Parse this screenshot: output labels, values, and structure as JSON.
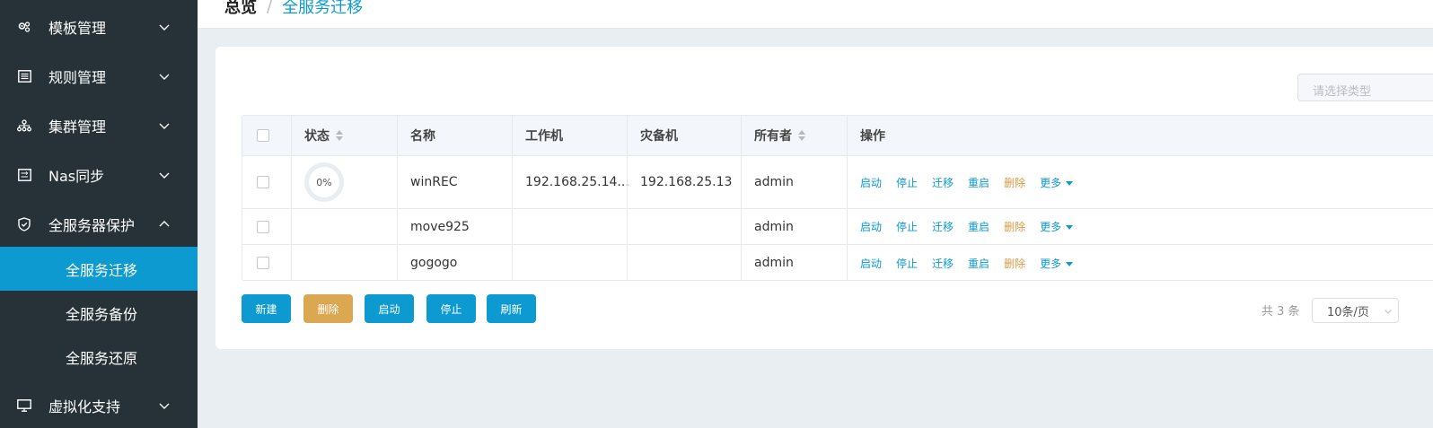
{
  "sidebar": {
    "items": [
      {
        "label": "模板管理",
        "icon": "gears-icon"
      },
      {
        "label": "规则管理",
        "icon": "list-icon"
      },
      {
        "label": "集群管理",
        "icon": "cluster-icon"
      },
      {
        "label": "Nas同步",
        "icon": "nas-icon"
      },
      {
        "label": "全服务器保护",
        "icon": "shield-icon",
        "expanded": true
      },
      {
        "label": "虚拟化支持",
        "icon": "monitor-icon"
      }
    ],
    "sub_items": [
      {
        "label": "全服务迁移",
        "active": true
      },
      {
        "label": "全服务备份"
      },
      {
        "label": "全服务还原"
      }
    ]
  },
  "breadcrumb": {
    "home": "总览",
    "separator": "/",
    "current": "全服务迁移"
  },
  "filter": {
    "type_placeholder": "请选择类型"
  },
  "table": {
    "columns": [
      "状态",
      "名称",
      "工作机",
      "灾备机",
      "所有者",
      "操作"
    ],
    "rows": [
      {
        "status": "0%",
        "name": "winREC",
        "work": "192.168.25.14...",
        "backup": "192.168.25.13",
        "owner": "admin"
      },
      {
        "status": "",
        "name": "move925",
        "work": "",
        "backup": "",
        "owner": "admin"
      },
      {
        "status": "",
        "name": "gogogo",
        "work": "",
        "backup": "",
        "owner": "admin"
      }
    ],
    "actions": [
      "启动",
      "停止",
      "迁移",
      "重启",
      "删除",
      "更多"
    ]
  },
  "buttons": {
    "new": "新建",
    "delete": "删除",
    "start": "启动",
    "stop": "停止",
    "refresh": "刷新"
  },
  "pagination": {
    "total": "共 3 条",
    "page_size": "10条/页"
  },
  "colors": {
    "sidebar_bg": "#263238",
    "accent": "#0d9ad0",
    "warning": "#dba750"
  }
}
